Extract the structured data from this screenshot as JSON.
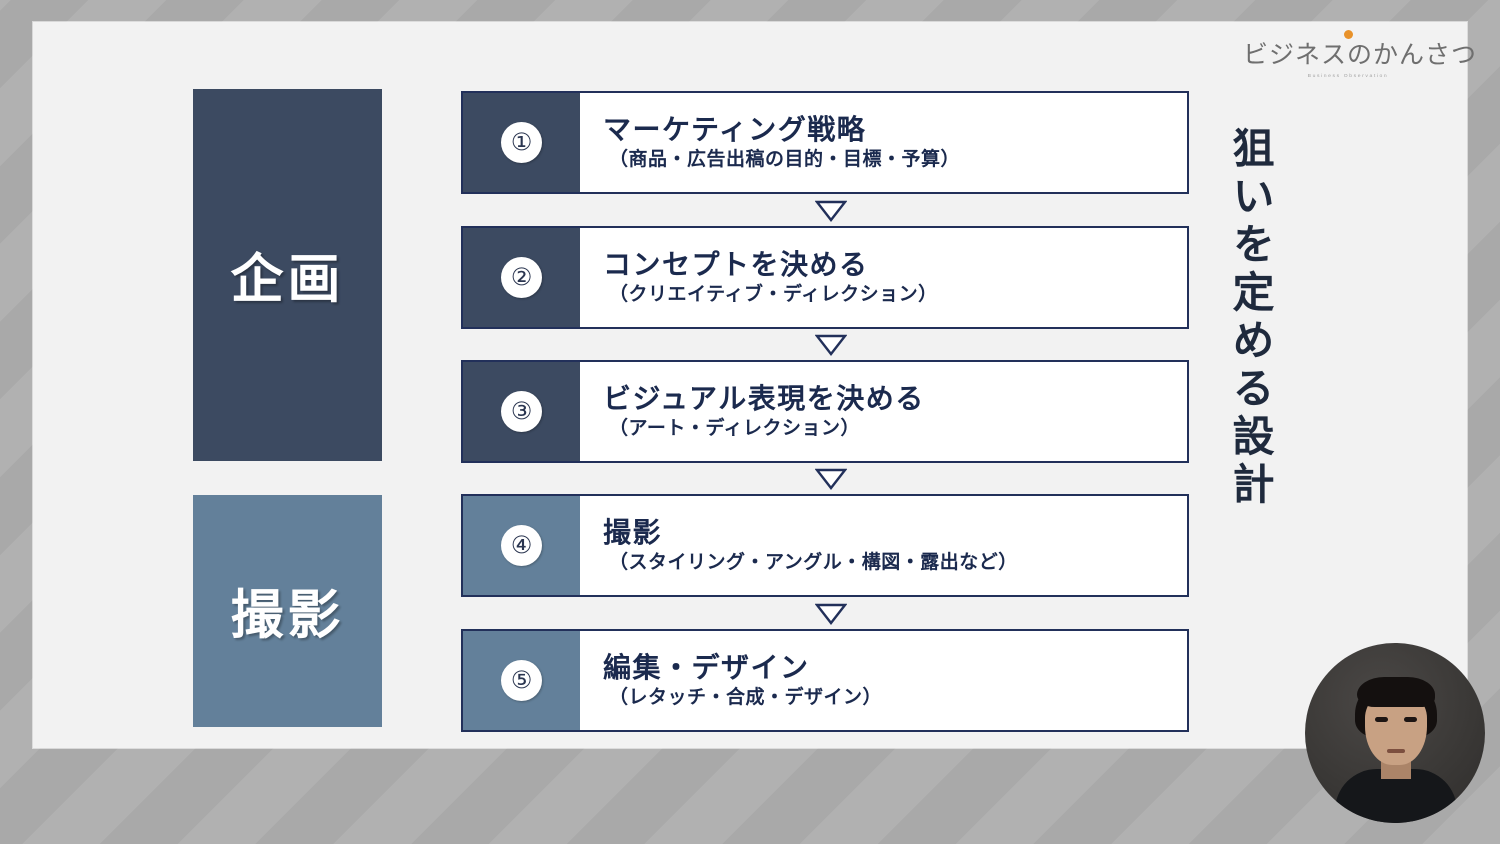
{
  "slide": {
    "logo": {
      "wordmark": "ビジネスのかんさつ",
      "subtitle": "Business Observation",
      "dot_color": "#e8922a"
    },
    "side_caption": "狙いを定める設計",
    "categories": [
      {
        "label": "企画",
        "color": "#3c4a61"
      },
      {
        "label": "撮影",
        "color": "#63809a"
      }
    ],
    "steps": [
      {
        "number": "①",
        "title": "マーケティング戦略",
        "subtitle": "（商品・広告出稿の目的・目標・予算）",
        "tone": "dark"
      },
      {
        "number": "②",
        "title": "コンセプトを決める",
        "subtitle": "（クリエイティブ・ディレクション）",
        "tone": "dark"
      },
      {
        "number": "③",
        "title": "ビジュアル表現を決める",
        "subtitle": "（アート・ディレクション）",
        "tone": "dark"
      },
      {
        "number": "④",
        "title": "撮影",
        "subtitle": "（スタイリング・アングル・構図・露出など）",
        "tone": "light"
      },
      {
        "number": "⑤",
        "title": "編集・デザイン",
        "subtitle": "（レタッチ・合成・デザイン）",
        "tone": "light"
      }
    ],
    "connector_count": 4,
    "colors": {
      "panel_background": "#f2f2f2",
      "stage_background": "#aeaeae",
      "accent_dark": "#3c4a61",
      "accent_light": "#63809a",
      "text_navy": "#1b2a4e",
      "box_border": "#22305a"
    }
  }
}
